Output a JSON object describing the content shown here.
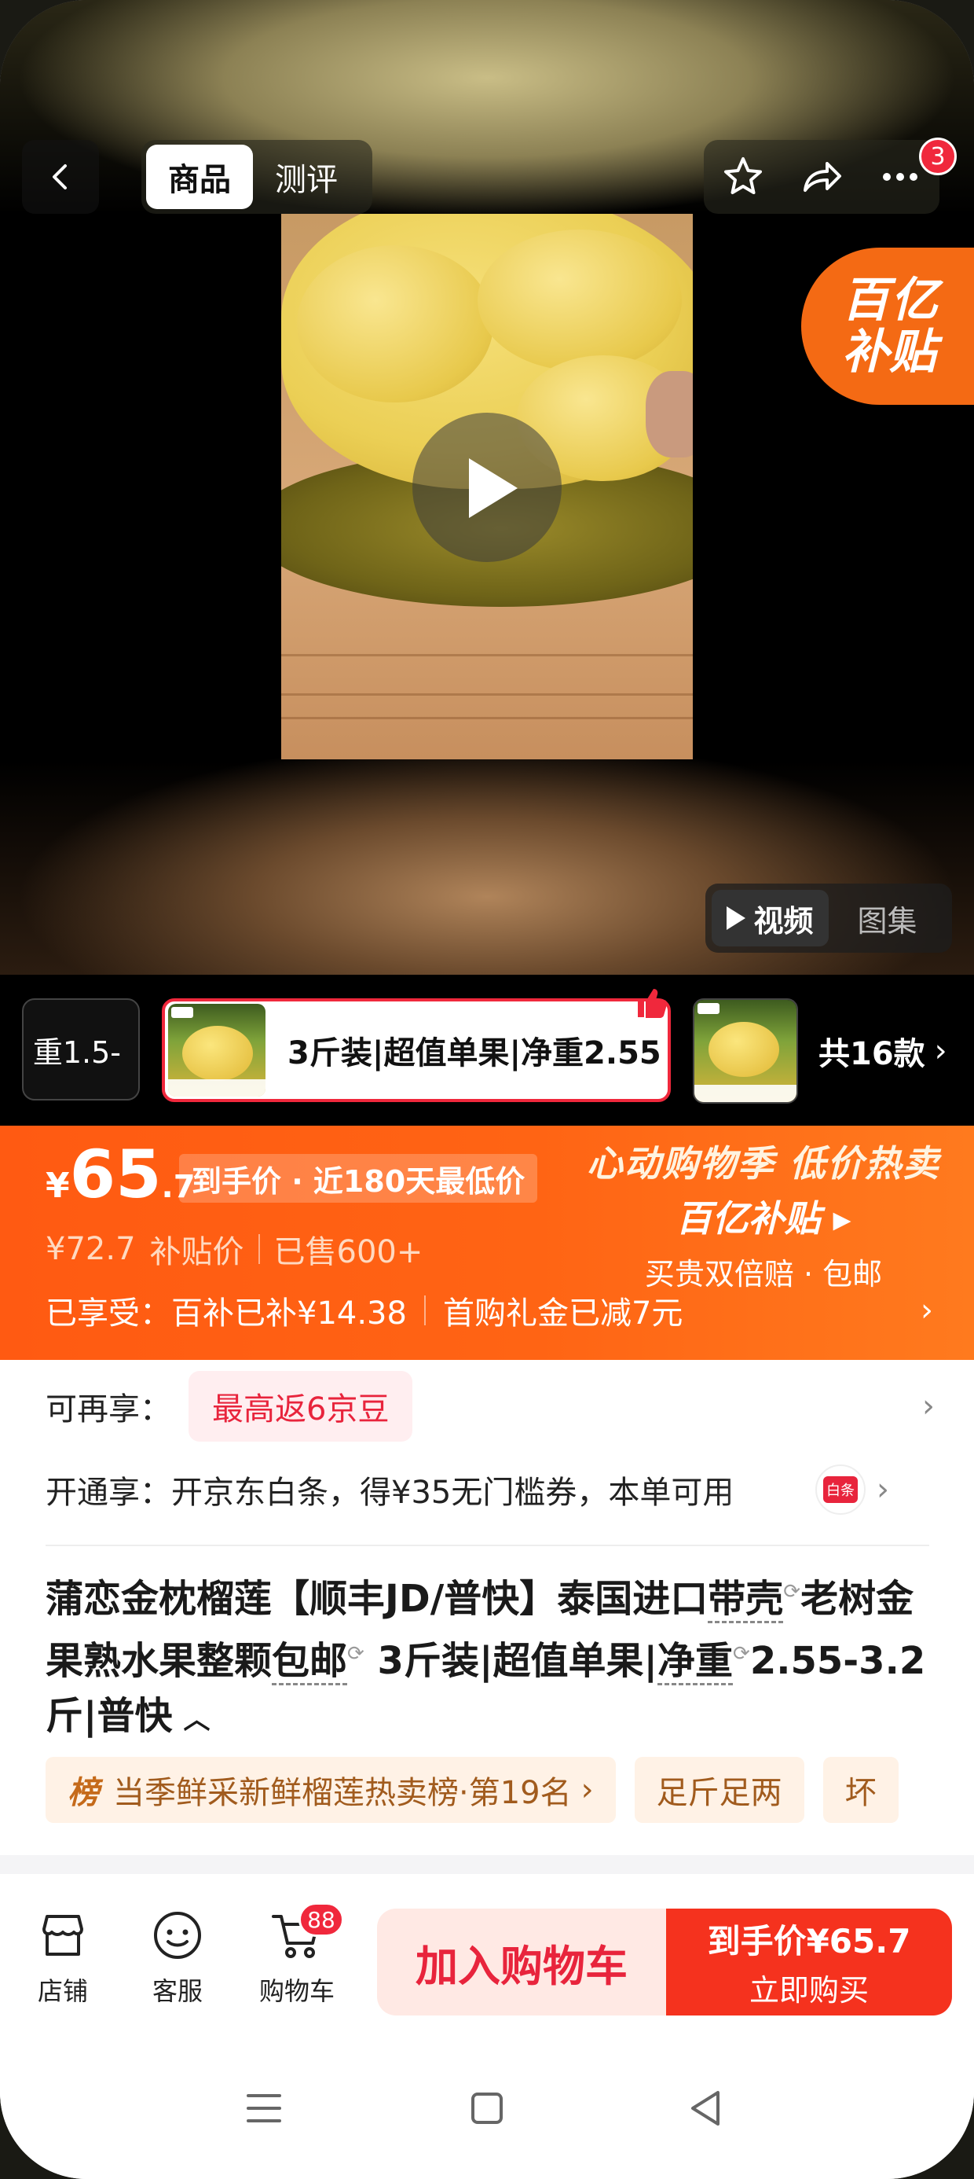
{
  "top_bar": {
    "tabs": [
      {
        "label": "商品",
        "active": true
      },
      {
        "label": "测评",
        "active": false
      }
    ],
    "share_badge_count": "3",
    "icons": [
      "back-icon",
      "star-icon",
      "share-icon",
      "more-icon"
    ]
  },
  "media": {
    "subsidy_badge": {
      "line1": "百亿",
      "line2": "补贴"
    },
    "switch": [
      {
        "label": "视频",
        "active": true
      },
      {
        "label": "图集",
        "active": false
      }
    ]
  },
  "variants": {
    "left_label": "重1.5-",
    "selected_label": "3斤装|超值单果|净重2.55",
    "total_label": "共16款"
  },
  "price_banner": {
    "currency": "¥",
    "price_int": "65",
    "price_dec": ".7",
    "price_tag": "到手价 · 近180天最低价",
    "subsidy_price": "¥72.7",
    "subsidy_price_label": "补贴价",
    "sold": "已售600+",
    "enjoyed_label": "已享受：",
    "enjoyed_1": "百补已补¥14.38",
    "enjoyed_2": "首购礼金已减7元",
    "promo_line1": "心动购物季 低价热卖",
    "promo_line2": "百亿补贴 ▸",
    "promo_line3": "买贵双倍赔 · 包邮"
  },
  "benefits": {
    "row1_label": "可再享：",
    "row1_pill": "最高返6京豆",
    "row2_label": "开通享：",
    "row2_text": "开京东白条，得¥35无门槛券，本单可用",
    "baitiao_icon_text": "白条"
  },
  "title": {
    "part1": "蒲恋金枕榴莲【顺丰JD/普快】泰国进口",
    "part2": "带壳",
    "part3": "老树金果熟水果整颗",
    "part4": "包邮",
    "part5": " 3斤装|超值单果|",
    "part6": "净重",
    "part7": "2.55-3.2斤|普快"
  },
  "chips": {
    "rank_icon": "榜",
    "rank_text": "当季鲜采新鲜榴莲热卖榜·第19名",
    "chip2": "足斤足两",
    "chip3": "坏"
  },
  "bottom_bar": {
    "store_label": "店铺",
    "service_label": "客服",
    "cart_label": "购物车",
    "cart_count": "88",
    "add_cart_label": "加入购物车",
    "buy_line1": "到手价¥65.7",
    "buy_line2": "立即购买"
  },
  "colors": {
    "accent_orange": "#ff5a12",
    "accent_red": "#f0283c",
    "buy_button": "#f5321e"
  }
}
